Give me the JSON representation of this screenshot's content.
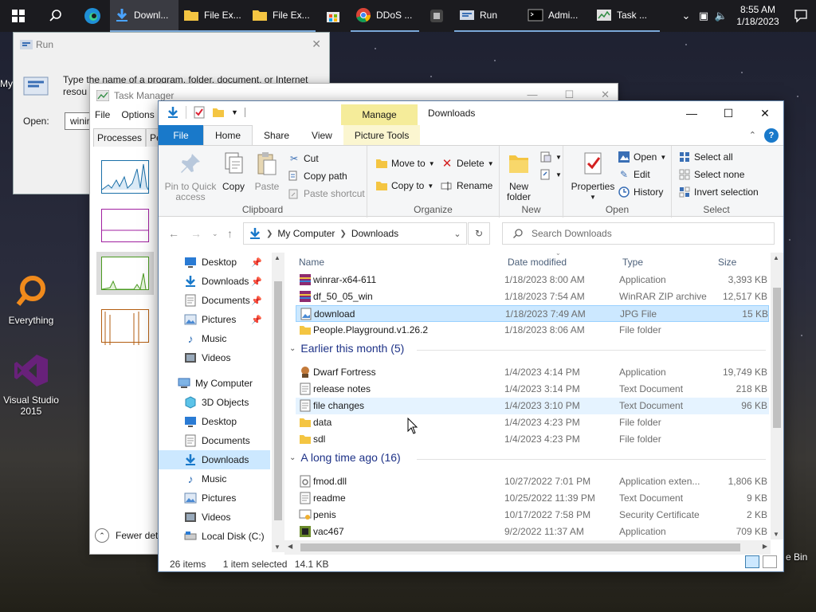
{
  "taskbar": {
    "apps": [
      {
        "label": "Downl...",
        "icon": "download-arrow-icon",
        "active": true
      },
      {
        "label": "File Ex...",
        "icon": "folder-icon"
      },
      {
        "label": "File Ex...",
        "icon": "folder-icon"
      },
      {
        "label": "",
        "icon": "store-icon"
      },
      {
        "label": "DDoS ...",
        "icon": "chrome-icon"
      },
      {
        "label": "",
        "icon": "app-icon"
      },
      {
        "label": "Run",
        "icon": "run-icon"
      },
      {
        "label": "Admi...",
        "icon": "cmd-icon"
      },
      {
        "label": "Task ...",
        "icon": "task-manager-icon"
      }
    ],
    "clock_time": "8:55 AM",
    "clock_date": "1/18/2023"
  },
  "desktop": {
    "icons": [
      {
        "label": "Everything"
      },
      {
        "label": "Visual Studio 2015"
      }
    ],
    "partial_left": "My",
    "partial_right": "e Bin"
  },
  "run_dialog": {
    "title": "Run",
    "text": "Type the name of a program, folder, document, or Internet resou",
    "open_label": "Open:",
    "input_value": "winir"
  },
  "task_manager": {
    "title": "Task Manager",
    "menu": [
      "File",
      "Options"
    ],
    "tabs": [
      "Processes",
      "Pe"
    ],
    "fewer_details": "Fewer det"
  },
  "explorer": {
    "title": "Downloads",
    "context_tab": "Manage",
    "tabs": {
      "file": "File",
      "home": "Home",
      "share": "Share",
      "view": "View",
      "picture_tools": "Picture Tools"
    },
    "ribbon": {
      "clipboard": {
        "label": "Clipboard",
        "pin": "Pin to Quick access",
        "copy": "Copy",
        "paste": "Paste",
        "cut": "Cut",
        "copy_path": "Copy path",
        "paste_shortcut": "Paste shortcut"
      },
      "organize": {
        "label": "Organize",
        "move_to": "Move to",
        "copy_to": "Copy to",
        "delete": "Delete",
        "rename": "Rename"
      },
      "new": {
        "label": "New",
        "new_folder": "New folder"
      },
      "open": {
        "label": "Open",
        "properties": "Properties",
        "open": "Open",
        "edit": "Edit",
        "history": "History"
      },
      "select": {
        "label": "Select",
        "select_all": "Select all",
        "select_none": "Select none",
        "invert": "Invert selection"
      }
    },
    "address": {
      "root": "My Computer",
      "current": "Downloads"
    },
    "search_placeholder": "Search Downloads",
    "nav": {
      "quick": [
        "Desktop",
        "Downloads",
        "Documents",
        "Pictures",
        "Music",
        "Videos"
      ],
      "computer": "My Computer",
      "computer_items": [
        "3D Objects",
        "Desktop",
        "Documents",
        "Downloads",
        "Music",
        "Pictures",
        "Videos",
        "Local Disk (C:)"
      ]
    },
    "columns": {
      "name": "Name",
      "date": "Date modified",
      "type": "Type",
      "size": "Size"
    },
    "groups": [
      {
        "header": "",
        "rows": [
          {
            "name": "winrar-x64-611",
            "date": "1/18/2023 8:00 AM",
            "type": "Application",
            "size": "3,393 KB",
            "icon": "winrar-icon"
          },
          {
            "name": "df_50_05_win",
            "date": "1/18/2023 7:54 AM",
            "type": "WinRAR ZIP archive",
            "size": "12,517 KB",
            "icon": "winrar-icon"
          },
          {
            "name": "download",
            "date": "1/18/2023 7:49 AM",
            "type": "JPG File",
            "size": "15 KB",
            "icon": "image-file-icon",
            "selected": true
          },
          {
            "name": "People.Playground.v1.26.2",
            "date": "1/18/2023 8:06 AM",
            "type": "File folder",
            "size": "",
            "icon": "folder-icon"
          }
        ]
      },
      {
        "header": "Earlier this month (5)",
        "rows": [
          {
            "name": "Dwarf Fortress",
            "date": "1/4/2023 4:14 PM",
            "type": "Application",
            "size": "19,749 KB",
            "icon": "app-icon"
          },
          {
            "name": "release notes",
            "date": "1/4/2023 3:14 PM",
            "type": "Text Document",
            "size": "218 KB",
            "icon": "text-file-icon"
          },
          {
            "name": "file changes",
            "date": "1/4/2023 3:10 PM",
            "type": "Text Document",
            "size": "96 KB",
            "icon": "text-file-icon",
            "hover": true
          },
          {
            "name": "data",
            "date": "1/4/2023 4:23 PM",
            "type": "File folder",
            "size": "",
            "icon": "folder-icon"
          },
          {
            "name": "sdl",
            "date": "1/4/2023 4:23 PM",
            "type": "File folder",
            "size": "",
            "icon": "folder-icon"
          }
        ]
      },
      {
        "header": "A long time ago (16)",
        "rows": [
          {
            "name": "fmod.dll",
            "date": "10/27/2022 7:01 PM",
            "type": "Application exten...",
            "size": "1,806 KB",
            "icon": "dll-file-icon"
          },
          {
            "name": "readme",
            "date": "10/25/2022 11:39 PM",
            "type": "Text Document",
            "size": "9 KB",
            "icon": "text-file-icon"
          },
          {
            "name": "penis",
            "date": "10/17/2022 7:58 PM",
            "type": "Security Certificate",
            "size": "2 KB",
            "icon": "certificate-icon"
          },
          {
            "name": "vac467",
            "date": "9/2/2022 11:37 AM",
            "type": "Application",
            "size": "709 KB",
            "icon": "app-icon"
          }
        ]
      }
    ],
    "status": {
      "items": "26 items",
      "selected": "1 item selected",
      "size": "14.1 KB"
    }
  },
  "colors": {
    "accent": "#1979ca",
    "selection": "#cce8ff",
    "context_band": "#f5ec9a",
    "group_header": "#1e3287"
  }
}
